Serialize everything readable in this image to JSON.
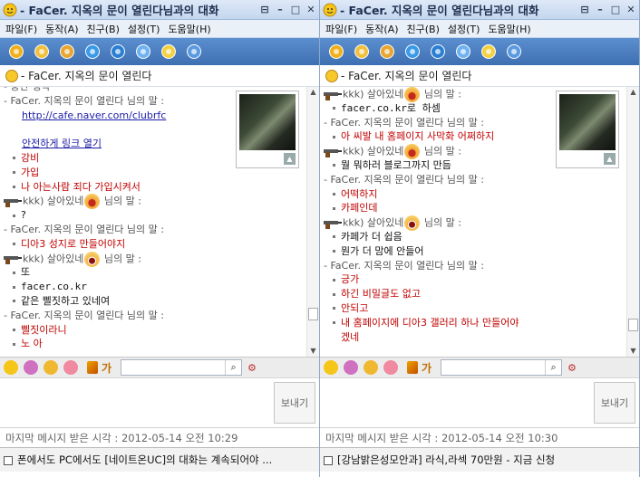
{
  "windows": [
    {
      "title": "- FaCer. 지옥의 문이 열린다님과의 대화",
      "menu": [
        "파일(F)",
        "동작(A)",
        "친구(B)",
        "설정(T)",
        "도움말(H)"
      ],
      "chat_header": "- FaCer. 지옥의 문이 열린다",
      "messages": [
        {
          "kind": "cut",
          "text": "- 중간 생략"
        },
        {
          "kind": "hdr",
          "text": "- FaCer. 지옥의 문이 열린다 님의 말 :"
        },
        {
          "kind": "link",
          "text": "http://cafe.naver.com/clubrfc"
        },
        {
          "kind": "blank",
          "text": ""
        },
        {
          "kind": "link",
          "text": "안전하게 링크 열기"
        },
        {
          "kind": "mine",
          "text": "강비"
        },
        {
          "kind": "mine",
          "text": "가입"
        },
        {
          "kind": "mine",
          "text": "나 아는사람 죄다 가입시켜서"
        },
        {
          "kind": "hdr2",
          "text": "kkk) 살아있네",
          "emo": "angry",
          "suffix": " 님의 말 :"
        },
        {
          "kind": "other",
          "text": "?"
        },
        {
          "kind": "hdr",
          "text": "- FaCer. 지옥의 문이 열린다 님의 말 :"
        },
        {
          "kind": "mine",
          "text": "디아3 성지로 만들어야지"
        },
        {
          "kind": "hdr2",
          "text": "kkk) 살아있네",
          "emo": "laugh",
          "suffix": " 님의 말 :"
        },
        {
          "kind": "other",
          "text": "또"
        },
        {
          "kind": "othermono",
          "text": "facer.co.kr"
        },
        {
          "kind": "other",
          "text": "같은 삘짓하고 있네여"
        },
        {
          "kind": "hdr",
          "text": "- FaCer. 지옥의 문이 열린다 님의 말 :"
        },
        {
          "kind": "mine",
          "text": "삘짓이라니"
        },
        {
          "kind": "mine",
          "text": "노 아"
        }
      ],
      "send_label": "보내기",
      "status": "마지막 메시지 받은 시각 : 2012-05-14 오전 10:29",
      "ad": "폰에서도 PC에서도 [네이트온UC]의 대화는 계속되어야 ..."
    },
    {
      "title": "- FaCer. 지옥의 문이 열린다님과의 대화",
      "menu": [
        "파일(F)",
        "동작(A)",
        "친구(B)",
        "설정(T)",
        "도움말(H)"
      ],
      "chat_header": "- FaCer. 지옥의 문이 열린다",
      "messages": [
        {
          "kind": "hdr2",
          "text": "kkk) 살아있네",
          "emo": "angry",
          "suffix": " 님의 말 :"
        },
        {
          "kind": "othermono",
          "text": "facer.co.kr로 하셈"
        },
        {
          "kind": "hdr",
          "text": "- FaCer. 지옥의 문이 열린다 님의 말 :"
        },
        {
          "kind": "mine",
          "text": "아 씨발 내 홈페이지 사막화 어쩌하지"
        },
        {
          "kind": "hdr2",
          "text": "kkk) 살아있네",
          "emo": "angry",
          "suffix": " 님의 말 :"
        },
        {
          "kind": "other",
          "text": "뭘 뭐하러 블로그까지 만듬"
        },
        {
          "kind": "hdr",
          "text": "- FaCer. 지옥의 문이 열린다 님의 말 :"
        },
        {
          "kind": "mine",
          "text": "어떡하지"
        },
        {
          "kind": "mine",
          "text": "카페인데"
        },
        {
          "kind": "hdr2",
          "text": "kkk) 살아있네",
          "emo": "laugh",
          "suffix": " 님의 말 :"
        },
        {
          "kind": "other",
          "text": "카페가 더 쉽음"
        },
        {
          "kind": "other",
          "text": "뭔가 더 맘에 안들어"
        },
        {
          "kind": "hdr",
          "text": "- FaCer. 지옥의 문이 열린다 님의 말 :"
        },
        {
          "kind": "mine",
          "text": "긍가"
        },
        {
          "kind": "mine",
          "text": "하긴 비밀글도 없고"
        },
        {
          "kind": "mine",
          "text": "안되고"
        },
        {
          "kind": "mine",
          "text": "내 홈페이지에 디아3 갤러리 하나 만들어야"
        },
        {
          "kind": "minecont",
          "text": "겠네"
        }
      ],
      "send_label": "보내기",
      "status": "마지막 메시지 받은 시각 : 2012-05-14 오전 10:30",
      "ad": "[강남밝은성모안과] 라식,라섹 70만원 - 지금 신청"
    }
  ],
  "colors": {
    "my_text": "#c00000",
    "link": "#1a1aa8",
    "toolbar": "#4a7dc0"
  },
  "toolbar_icons": [
    "add-friend-icon",
    "send-file-icon",
    "group-chat-icon",
    "remote-icon",
    "screen-icon",
    "time-icon",
    "emoticon-icon",
    "search-icon"
  ],
  "input_icons": [
    "emoticon-icon",
    "gift-icon",
    "character-icon",
    "flower-icon",
    "pen-icon",
    "font-icon"
  ]
}
